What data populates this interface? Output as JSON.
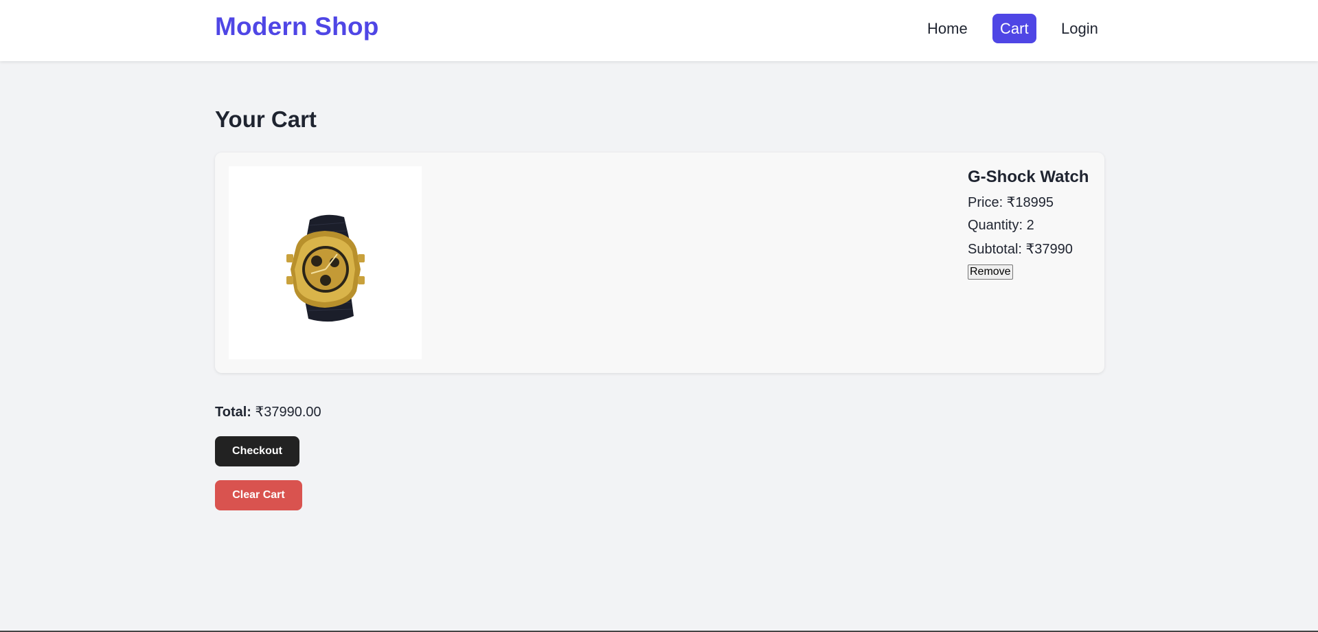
{
  "header": {
    "brand": "Modern Shop",
    "nav": [
      {
        "label": "Home"
      },
      {
        "label": "Cart"
      },
      {
        "label": "Login"
      }
    ]
  },
  "page_title": "Your Cart",
  "cart": {
    "items": [
      {
        "name": "G-Shock Watch",
        "price_text": "Price: ₹18995",
        "quantity_text": "Quantity: 2",
        "subtotal_text": "Subtotal: ₹37990",
        "remove_label": "Remove",
        "image_icon": "gold-watch-icon"
      }
    ],
    "total_label": "Total:",
    "total_value": "₹37990.00",
    "checkout_label": "Checkout",
    "clear_label": "Clear Cart"
  },
  "colors": {
    "brand": "#4f46e5",
    "checkout": "#222222",
    "clear": "#d9534f",
    "background": "#f2f3f5"
  }
}
